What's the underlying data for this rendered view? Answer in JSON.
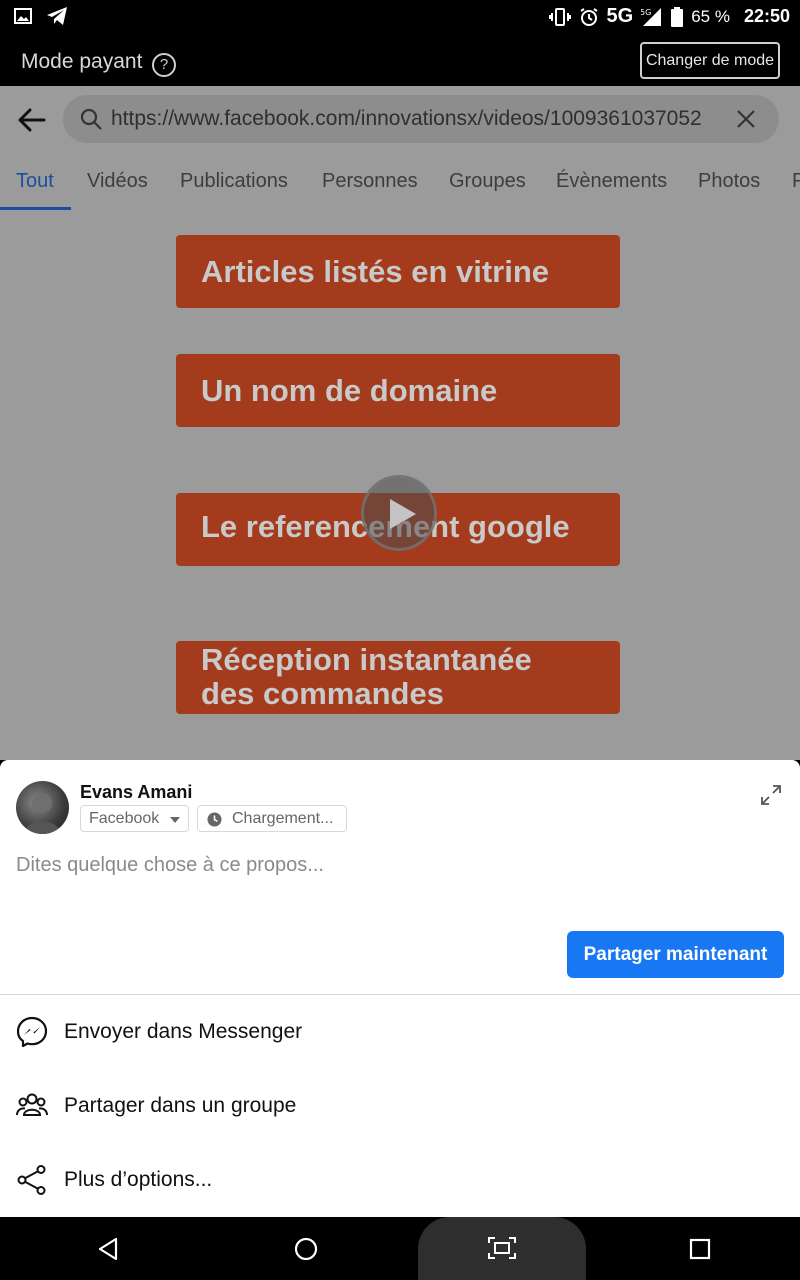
{
  "status_bar": {
    "network": "5G",
    "network_small": "5G",
    "battery": "65 %",
    "time": "22:50",
    "icons": [
      "image-icon",
      "telegram-icon",
      "vibrate-icon",
      "alarm-icon",
      "signal-icon",
      "battery-icon"
    ]
  },
  "mode_bar": {
    "title": "Mode payant",
    "help": "?",
    "button": "Changer de mode"
  },
  "search": {
    "url": "https://www.facebook.com/innovationsx/videos/1009361037052"
  },
  "tabs": [
    {
      "label": "Tout",
      "active": true
    },
    {
      "label": "Vidéos"
    },
    {
      "label": "Publications"
    },
    {
      "label": "Personnes"
    },
    {
      "label": "Groupes"
    },
    {
      "label": "Évènements"
    },
    {
      "label": "Photos"
    },
    {
      "label": "P"
    }
  ],
  "video": {
    "banners": [
      "Articles listés en vitrine",
      "Un nom de domaine",
      "Le referencement google",
      "Réception instantanée",
      "des commandes"
    ]
  },
  "share_sheet": {
    "user_name": "Evans Amani",
    "audience": "Facebook",
    "status": "Chargement...",
    "placeholder": "Dites quelque chose à ce propos...",
    "share_button": "Partager maintenant",
    "options": [
      {
        "label": "Envoyer dans Messenger",
        "icon": "messenger-icon"
      },
      {
        "label": "Partager dans un groupe",
        "icon": "group-icon"
      },
      {
        "label": "Plus d’options...",
        "icon": "share-icon"
      }
    ]
  },
  "colors": {
    "accent": "#1877f2",
    "active_tab": "#1a4fa0",
    "banner": "#a33b1c"
  }
}
